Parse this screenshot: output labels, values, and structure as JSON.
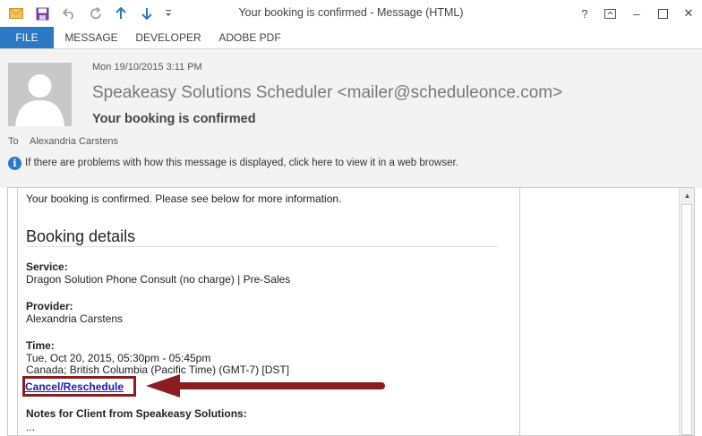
{
  "window": {
    "title": "Your booking is confirmed - Message (HTML)",
    "help": "?",
    "minimize": "–",
    "close": "✕"
  },
  "ribbon": {
    "tabs": [
      "FILE",
      "MESSAGE",
      "DEVELOPER",
      "ADOBE PDF"
    ]
  },
  "message": {
    "date": "Mon 19/10/2015 3:11 PM",
    "sender": "Speakeasy Solutions Scheduler <mailer@scheduleonce.com>",
    "subject": "Your booking is confirmed",
    "to_label": "To",
    "to_value": "Alexandria Carstens",
    "info_bar": "If there are problems with how this message is displayed, click here to view it in a web browser."
  },
  "body": {
    "intro": "Your booking is confirmed. Please see below for more information.",
    "heading": "Booking details",
    "service_label": "Service:",
    "service_value": "Dragon Solution Phone Consult (no charge) | Pre-Sales",
    "provider_label": "Provider:",
    "provider_value": "Alexandria Carstens",
    "time_label": "Time:",
    "time_value": "Tue, Oct 20, 2015, 05:30pm - 05:45pm",
    "timezone": "Canada; British Columbia (Pacific Time) (GMT-7) [DST]",
    "cancel_link": "Cancel/Reschedule",
    "notes_label": "Notes for Client from Speakeasy Solutions:",
    "notes_value": "..."
  },
  "colors": {
    "accent": "#2b79c2",
    "annotation": "#8a1d22",
    "link": "#1a1ab0"
  }
}
